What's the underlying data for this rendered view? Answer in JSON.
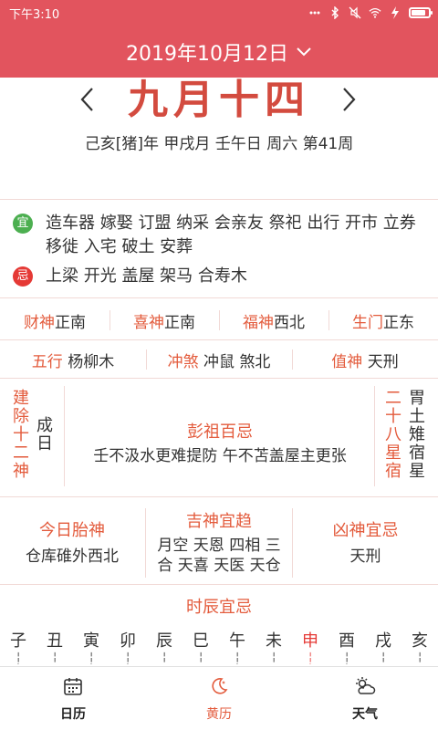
{
  "status_bar": {
    "time": "下午3:10"
  },
  "header": {
    "date": "2019年10月12日"
  },
  "lunar": {
    "day": "九月十四",
    "ganzhi": "己亥[猪]年 甲戌月 壬午日 周六 第41周"
  },
  "yi": {
    "badge": "宜",
    "text": "造车器 嫁娶 订盟 纳采 会亲友 祭祀 出行 开市 立券 移徙 入宅 破土 安葬"
  },
  "ji": {
    "badge": "忌",
    "text": "上梁 开光 盖屋 架马 合寿木"
  },
  "gods1": [
    {
      "label": "财神",
      "value": "正南"
    },
    {
      "label": "喜神",
      "value": "正南"
    },
    {
      "label": "福神",
      "value": "西北"
    },
    {
      "label": "生门",
      "value": "正东"
    }
  ],
  "gods2": [
    {
      "label": "五行",
      "value": "杨柳木"
    },
    {
      "label": "冲煞",
      "value": "冲鼠 煞北"
    },
    {
      "label": "值神",
      "value": "天刑"
    }
  ],
  "jianchu": {
    "label": [
      "建",
      "除",
      "十",
      "二",
      "神"
    ],
    "value": [
      "成",
      "日"
    ]
  },
  "pengzu": {
    "title": "彭祖百忌",
    "text": "壬不汲水更难提防 午不苫盖屋主更张"
  },
  "xiu": {
    "label": [
      "二",
      "十",
      "八",
      "星",
      "宿"
    ],
    "value": [
      "胃",
      "土",
      "雉",
      "宿",
      "星"
    ]
  },
  "taishen": {
    "title": "今日胎神",
    "text": "仓库碓外西北"
  },
  "jishen": {
    "title": "吉神宜趋",
    "line1": "月空 天恩 四相 三",
    "line2": "合 天喜 天医 天仓"
  },
  "xiongshen": {
    "title": "凶神宜忌",
    "text": "天刑"
  },
  "shichen": {
    "title": "时辰宜忌",
    "hours": [
      {
        "name": "子",
        "sub": "吉"
      },
      {
        "name": "丑",
        "sub": "凶"
      },
      {
        "name": "寅",
        "sub": "吉"
      },
      {
        "name": "卯",
        "sub": "吉"
      },
      {
        "name": "辰",
        "sub": "凶"
      },
      {
        "name": "巳",
        "sub": "凶"
      },
      {
        "name": "午",
        "sub": "吉"
      },
      {
        "name": "未",
        "sub": "凶"
      },
      {
        "name": "申",
        "sub": "吉"
      },
      {
        "name": "酉",
        "sub": "吉"
      },
      {
        "name": "戌",
        "sub": "凶"
      },
      {
        "name": "亥",
        "sub": "凶"
      }
    ],
    "active_index": 8
  },
  "nav": [
    {
      "label": "日历",
      "icon": "calendar-icon"
    },
    {
      "label": "黄历",
      "icon": "moon-icon"
    },
    {
      "label": "天气",
      "icon": "weather-icon"
    }
  ],
  "colors": {
    "header": "#e2545e",
    "accent": "#e35b3c",
    "yi": "#4caf50",
    "ji": "#e53935"
  }
}
